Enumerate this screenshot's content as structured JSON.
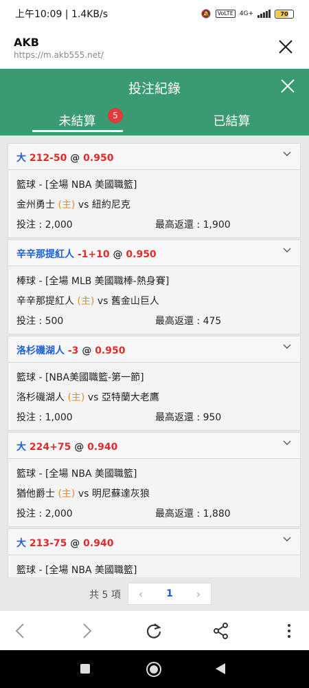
{
  "status_bar": {
    "time_text": "上午10:09 | 1.4KB/s",
    "volte_label": "VoLTE",
    "network_label": "4G+",
    "battery": "70"
  },
  "browser": {
    "site_name": "AKB",
    "url": "https://m.akb555.net/"
  },
  "modal": {
    "title": "投注紀錄",
    "tabs": [
      {
        "label": "未結算",
        "badge": "5",
        "active": true
      },
      {
        "label": "已結算",
        "active": false
      }
    ]
  },
  "bets": [
    {
      "selection": "大",
      "selection_color": "blue",
      "handicap": "212-50",
      "at": "@",
      "odds": "0.950",
      "league": "籃球 - [全場 NBA 美國職籃]",
      "home": "金州勇士",
      "home_tag": "(主)",
      "vs": "vs",
      "away": "紐約尼克",
      "stake_label": "投注 : 2,000",
      "payout_label": "最高返還 : 1,900"
    },
    {
      "selection": "辛辛那提紅人",
      "selection_color": "blue",
      "handicap": "-1+10",
      "at": "@",
      "odds": "0.950",
      "league": "棒球 - [全場 MLB 美國職棒-熱身賽]",
      "home": "辛辛那提紅人",
      "home_tag": "(主)",
      "vs": "vs",
      "away": "舊金山巨人",
      "stake_label": "投注 : 500",
      "payout_label": "最高返還 : 475"
    },
    {
      "selection": "洛杉磯湖人",
      "selection_color": "blue",
      "handicap": "-3",
      "at": "@",
      "odds": "0.950",
      "league": "籃球 - [NBA美國職籃-第一節]",
      "home": "洛杉磯湖人",
      "home_tag": "(主)",
      "vs": "vs",
      "away": "亞特蘭大老鷹",
      "stake_label": "投注 : 1,000",
      "payout_label": "最高返還 : 950"
    },
    {
      "selection": "大",
      "selection_color": "blue",
      "handicap": "224+75",
      "at": "@",
      "odds": "0.940",
      "league": "籃球 - [全場 NBA 美國職籃]",
      "home": "猶他爵士",
      "home_tag": "(主)",
      "vs": "vs",
      "away": "明尼蘇達灰狼",
      "stake_label": "投注 : 2,000",
      "payout_label": "最高返還 : 1,880"
    },
    {
      "selection": "大",
      "selection_color": "blue",
      "handicap": "213-75",
      "at": "@",
      "odds": "0.940",
      "league": "籃球 - [全場 NBA 美國職籃]"
    }
  ],
  "pagination": {
    "total_label": "共 5 項",
    "current_page": "1",
    "prev_icon": "‹",
    "next_icon": "›"
  },
  "colors": {
    "header_green": "#3a9b73",
    "selection_blue": "#1f5fd6",
    "odds_red": "#e02c2c",
    "home_tag_orange": "#e78a1e",
    "badge_red": "#e23b3b"
  }
}
